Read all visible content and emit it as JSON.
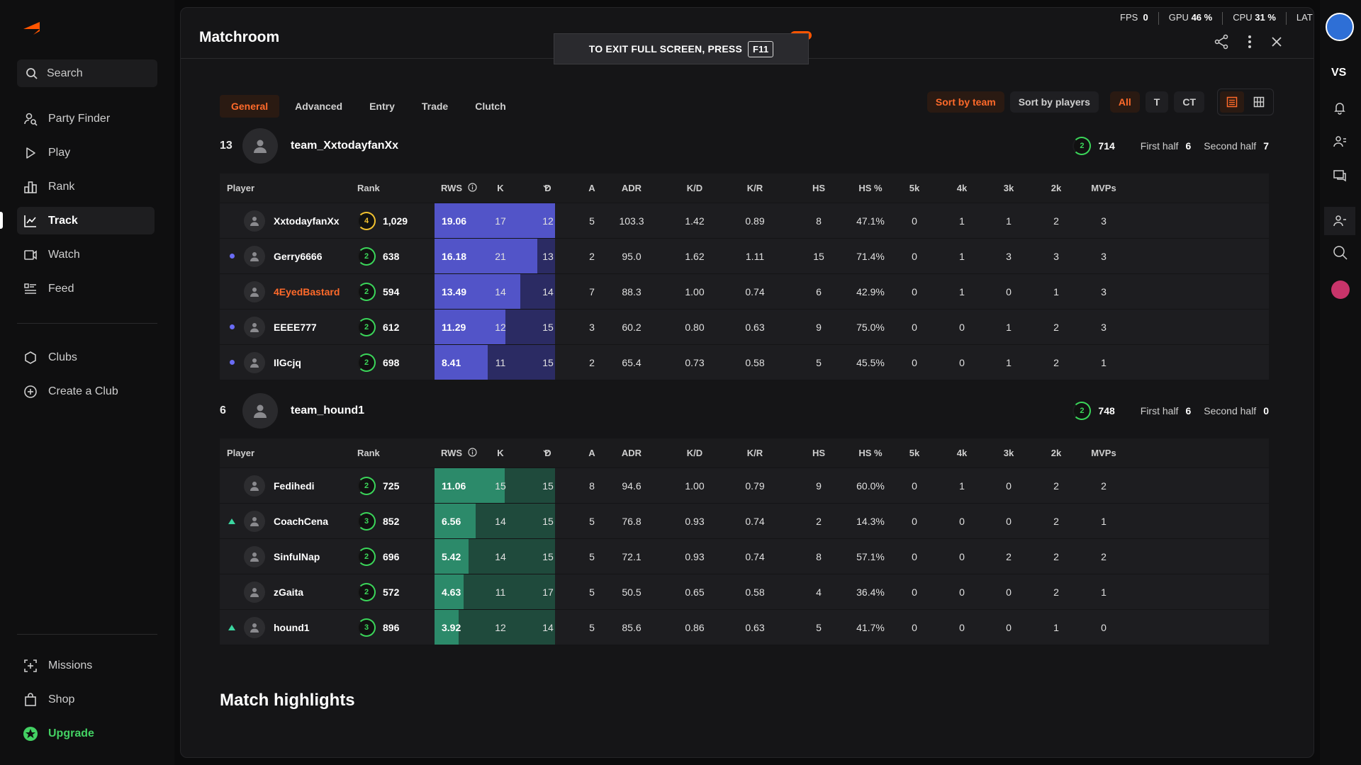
{
  "sidebar": {
    "search_label": "Search",
    "items": [
      {
        "label": "Party Finder",
        "icon": "party-finder-icon"
      },
      {
        "label": "Play",
        "icon": "play-icon"
      },
      {
        "label": "Rank",
        "icon": "rank-icon"
      },
      {
        "label": "Track",
        "icon": "track-icon"
      },
      {
        "label": "Watch",
        "icon": "watch-icon"
      },
      {
        "label": "Feed",
        "icon": "feed-icon"
      }
    ],
    "clubs": [
      {
        "label": "Clubs",
        "icon": "clubs-icon"
      },
      {
        "label": "Create a Club",
        "icon": "create-club-icon"
      }
    ],
    "bottom": [
      {
        "label": "Missions",
        "icon": "missions-icon"
      },
      {
        "label": "Shop",
        "icon": "shop-icon"
      },
      {
        "label": "Upgrade",
        "icon": "upgrade-icon"
      }
    ],
    "brand_color": "#ff5500",
    "upgrade_color": "#43d163"
  },
  "header": {
    "title": "Matchroom",
    "fullscreen_text": "TO EXIT FULL SCREEN, PRESS",
    "fullscreen_key": "F11"
  },
  "perf": {
    "fps_label": "FPS",
    "fps_value": "0",
    "gpu_label": "GPU",
    "gpu_value": "46 %",
    "cpu_label": "CPU",
    "cpu_value": "31 %",
    "lat_label": "LAT"
  },
  "rightbar": {
    "vs_label": "VS"
  },
  "tabs": [
    "General",
    "Advanced",
    "Entry",
    "Trade",
    "Clutch"
  ],
  "filters": {
    "sort_team": "Sort by team",
    "sort_players": "Sort by players",
    "sides": [
      "All",
      "T",
      "CT"
    ]
  },
  "columns": [
    "Player",
    "Rank",
    "RWS",
    "K",
    "D",
    "A",
    "ADR",
    "K/D",
    "K/R",
    "HS",
    "HS %",
    "5k",
    "4k",
    "3k",
    "2k",
    "MVPs"
  ],
  "teams": [
    {
      "score": "13",
      "name": "team_XxtodayfanXx",
      "level": "2",
      "elo": "714",
      "first_half_label": "First half",
      "first_half": "6",
      "second_half_label": "Second half",
      "second_half": "7",
      "players": [
        {
          "name": "XxtodayfanXx",
          "level": "4",
          "elo": "1,029",
          "rws": "19.06",
          "rws_frac": 1.0,
          "k": "17",
          "d": "12",
          "a": "5",
          "adr": "103.3",
          "kd": "1.42",
          "kr": "0.89",
          "hs": "8",
          "hsp": "47.1%",
          "k5": "0",
          "k4": "1",
          "k3": "1",
          "k2": "2",
          "mvps": "3",
          "mark": "",
          "me": false
        },
        {
          "name": "Gerry6666",
          "level": "2",
          "elo": "638",
          "rws": "16.18",
          "rws_frac": 0.85,
          "k": "21",
          "d": "13",
          "a": "2",
          "adr": "95.0",
          "kd": "1.62",
          "kr": "1.11",
          "hs": "15",
          "hsp": "71.4%",
          "k5": "0",
          "k4": "1",
          "k3": "3",
          "k2": "3",
          "mvps": "3",
          "mark": "dot",
          "me": false
        },
        {
          "name": "4EyedBastard",
          "level": "2",
          "elo": "594",
          "rws": "13.49",
          "rws_frac": 0.71,
          "k": "14",
          "d": "14",
          "a": "7",
          "adr": "88.3",
          "kd": "1.00",
          "kr": "0.74",
          "hs": "6",
          "hsp": "42.9%",
          "k5": "0",
          "k4": "1",
          "k3": "0",
          "k2": "1",
          "mvps": "3",
          "mark": "",
          "me": true
        },
        {
          "name": "EEEE777",
          "level": "2",
          "elo": "612",
          "rws": "11.29",
          "rws_frac": 0.59,
          "k": "12",
          "d": "15",
          "a": "3",
          "adr": "60.2",
          "kd": "0.80",
          "kr": "0.63",
          "hs": "9",
          "hsp": "75.0%",
          "k5": "0",
          "k4": "0",
          "k3": "1",
          "k2": "2",
          "mvps": "3",
          "mark": "dot",
          "me": false
        },
        {
          "name": "IlGcjq",
          "level": "2",
          "elo": "698",
          "rws": "8.41",
          "rws_frac": 0.44,
          "k": "11",
          "d": "15",
          "a": "2",
          "adr": "65.4",
          "kd": "0.73",
          "kr": "0.58",
          "hs": "5",
          "hsp": "45.5%",
          "k5": "0",
          "k4": "0",
          "k3": "1",
          "k2": "2",
          "mvps": "1",
          "mark": "dot",
          "me": false
        }
      ]
    },
    {
      "score": "6",
      "name": "team_hound1",
      "level": "2",
      "elo": "748",
      "first_half_label": "First half",
      "first_half": "6",
      "second_half_label": "Second half",
      "second_half": "0",
      "players": [
        {
          "name": "Fedihedi",
          "level": "2",
          "elo": "725",
          "rws": "11.06",
          "rws_frac": 0.58,
          "k": "15",
          "d": "15",
          "a": "8",
          "adr": "94.6",
          "kd": "1.00",
          "kr": "0.79",
          "hs": "9",
          "hsp": "60.0%",
          "k5": "0",
          "k4": "1",
          "k3": "0",
          "k2": "2",
          "mvps": "2",
          "mark": "",
          "me": false
        },
        {
          "name": "CoachCena",
          "level": "3",
          "elo": "852",
          "rws": "6.56",
          "rws_frac": 0.34,
          "k": "14",
          "d": "15",
          "a": "5",
          "adr": "76.8",
          "kd": "0.93",
          "kr": "0.74",
          "hs": "2",
          "hsp": "14.3%",
          "k5": "0",
          "k4": "0",
          "k3": "0",
          "k2": "2",
          "mvps": "1",
          "mark": "tri",
          "me": false
        },
        {
          "name": "SinfulNap",
          "level": "2",
          "elo": "696",
          "rws": "5.42",
          "rws_frac": 0.28,
          "k": "14",
          "d": "15",
          "a": "5",
          "adr": "72.1",
          "kd": "0.93",
          "kr": "0.74",
          "hs": "8",
          "hsp": "57.1%",
          "k5": "0",
          "k4": "0",
          "k3": "2",
          "k2": "2",
          "mvps": "2",
          "mark": "",
          "me": false
        },
        {
          "name": "zGaita",
          "level": "2",
          "elo": "572",
          "rws": "4.63",
          "rws_frac": 0.24,
          "k": "11",
          "d": "17",
          "a": "5",
          "adr": "50.5",
          "kd": "0.65",
          "kr": "0.58",
          "hs": "4",
          "hsp": "36.4%",
          "k5": "0",
          "k4": "0",
          "k3": "0",
          "k2": "2",
          "mvps": "1",
          "mark": "",
          "me": false
        },
        {
          "name": "hound1",
          "level": "3",
          "elo": "896",
          "rws": "3.92",
          "rws_frac": 0.2,
          "k": "12",
          "d": "14",
          "a": "5",
          "adr": "85.6",
          "kd": "0.86",
          "kr": "0.63",
          "hs": "5",
          "hsp": "41.7%",
          "k5": "0",
          "k4": "0",
          "k3": "0",
          "k2": "1",
          "mvps": "0",
          "mark": "tri",
          "me": false
        }
      ]
    }
  ],
  "highlights_title": "Match highlights"
}
